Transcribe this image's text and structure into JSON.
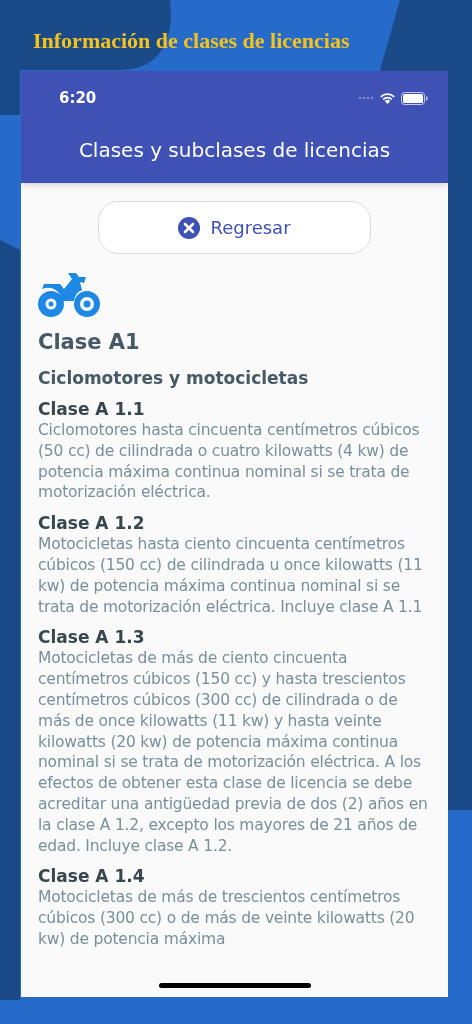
{
  "banner_title": "Información de clases de licencias",
  "status_bar": {
    "time": "6:20"
  },
  "app_bar": {
    "title": "Clases y subclases de licencias"
  },
  "back_button": {
    "label": "Regresar"
  },
  "class": {
    "title": "Clase A1",
    "subtitle": "Ciclomotores y motocicletas",
    "subclasses": [
      {
        "title": "Clase A 1.1",
        "description": "Ciclomotores hasta cincuenta centímetros cúbicos (50 cc) de cilindrada o cuatro kilowatts (4 kw) de potencia máxima continua nominal si se trata de motorización eléctrica."
      },
      {
        "title": "Clase A 1.2",
        "description": "Motocicletas hasta ciento cincuenta centímetros cúbicos (150 cc) de cilindrada u once kilowatts (11 kw) de potencia máxima continua nominal si se trata de motorización eléctrica. Incluye clase A 1.1"
      },
      {
        "title": "Clase A 1.3",
        "description": "Motocicletas de más de ciento cincuenta centímetros cúbicos (150 cc) y hasta trescientos centímetros cúbicos (300 cc) de cilindrada o de más de once kilowatts (11 kw) y hasta veinte kilowatts (20 kw) de potencia máxima continua nominal si se trata de motorización eléctrica. A los efectos de obtener esta clase de licencia se debe acreditar una antigüedad previa de dos (2) años en la clase A 1.2, excepto los mayores de 21 años de edad. Incluye clase A 1.2."
      },
      {
        "title": "Clase A 1.4",
        "description": "Motocicletas de más de trescientos centímetros cúbicos (300 cc) o de más de veinte kilowatts (20 kw) de potencia máxima"
      }
    ]
  }
}
